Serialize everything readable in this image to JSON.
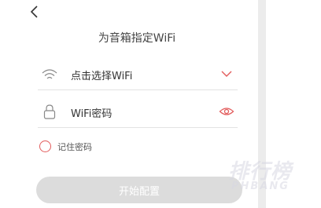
{
  "page_title": "为音箱指定WiFi",
  "wifi_row": {
    "label": "点击选择WiFi",
    "lead_icon": "wifi-icon",
    "tail_icon": "chevron-down-icon"
  },
  "password_row": {
    "label": "WiFi密码",
    "lead_icon": "lock-icon",
    "tail_icon": "eye-icon"
  },
  "remember": {
    "label": "记住密码",
    "checked": false
  },
  "start_button": {
    "label": "开始配置"
  },
  "watermark": {
    "text": "排行榜",
    "subtext": "PHBANG"
  },
  "colors": {
    "accent": "#e25b5b",
    "button_disabled": "#dcdcdc",
    "divider": "#e3e3e3"
  }
}
